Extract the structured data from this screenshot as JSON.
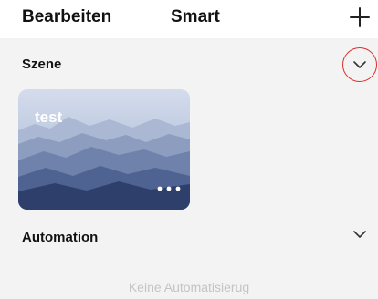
{
  "header": {
    "edit_label": "Bearbeiten",
    "title": "Smart",
    "add_icon": "plus-icon"
  },
  "scenes": {
    "title": "Szene",
    "expand_icon": "chevron-down-icon",
    "highlight_color": "#d9302c",
    "cards": [
      {
        "name": "test",
        "background": "misty-mountains-image",
        "more_icon": "more-dots-icon"
      }
    ]
  },
  "automation": {
    "title": "Automation",
    "expand_icon": "chevron-down-icon",
    "empty_text": "Keine Automatisierug"
  },
  "colors": {
    "background": "#f3f3f3",
    "header_background": "#ffffff",
    "text": "#111111",
    "muted_text": "#c4c4c4"
  }
}
